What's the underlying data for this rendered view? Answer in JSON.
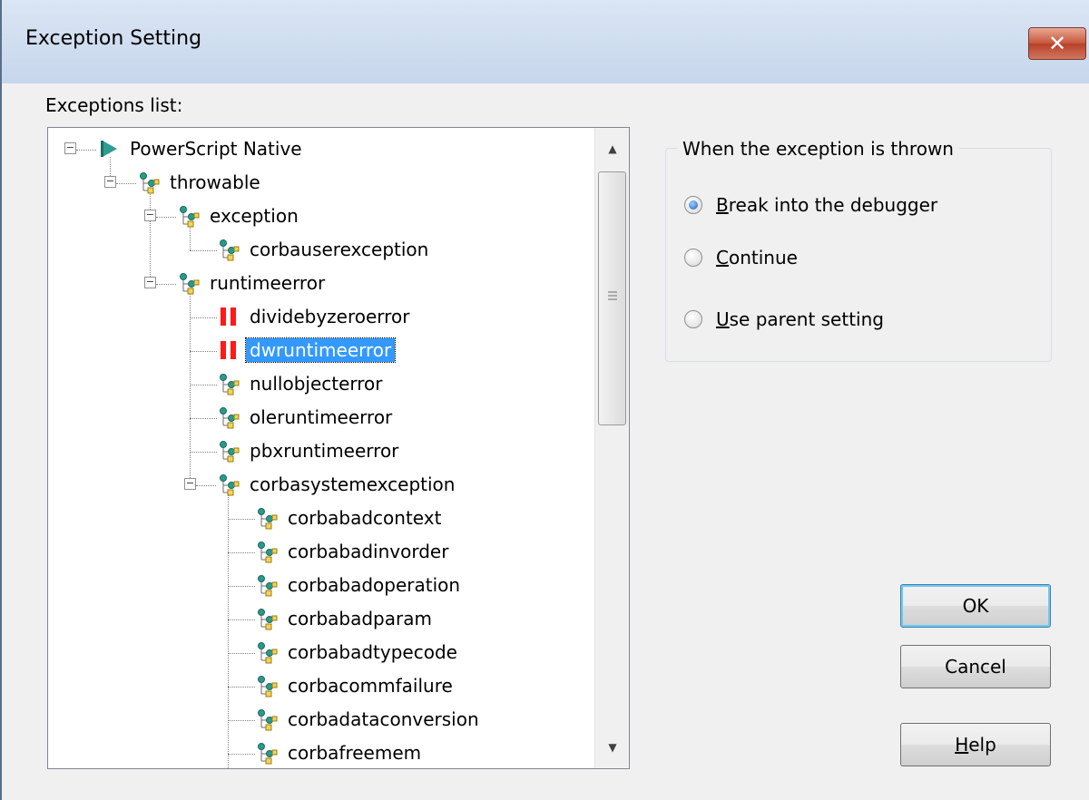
{
  "window": {
    "title": "Exception Setting",
    "close_glyph": "✕"
  },
  "exceptions_label": "Exceptions list:",
  "tree": {
    "nodes": [
      {
        "label": "PowerScript Native",
        "icon": "play-icon"
      },
      {
        "label": "throwable",
        "icon": "class-hierarchy-icon"
      },
      {
        "label": "exception",
        "icon": "class-hierarchy-icon"
      },
      {
        "label": "corbauserexception",
        "icon": "class-hierarchy-icon"
      },
      {
        "label": "runtimeerror",
        "icon": "class-hierarchy-icon"
      },
      {
        "label": "dividebyzeroerror",
        "icon": "break-icon"
      },
      {
        "label": "dwruntimeerror",
        "icon": "break-icon",
        "selected": true
      },
      {
        "label": "nullobjecterror",
        "icon": "class-hierarchy-icon"
      },
      {
        "label": "oleruntimeerror",
        "icon": "class-hierarchy-icon"
      },
      {
        "label": "pbxruntimeerror",
        "icon": "class-hierarchy-icon"
      },
      {
        "label": "corbasystemexception",
        "icon": "class-hierarchy-icon"
      },
      {
        "label": "corbabadcontext",
        "icon": "class-hierarchy-icon"
      },
      {
        "label": "corbabadinvorder",
        "icon": "class-hierarchy-icon"
      },
      {
        "label": "corbabadoperation",
        "icon": "class-hierarchy-icon"
      },
      {
        "label": "corbabadparam",
        "icon": "class-hierarchy-icon"
      },
      {
        "label": "corbabadtypecode",
        "icon": "class-hierarchy-icon"
      },
      {
        "label": "corbacommfailure",
        "icon": "class-hierarchy-icon"
      },
      {
        "label": "corbadataconversion",
        "icon": "class-hierarchy-icon"
      },
      {
        "label": "corbafreemem",
        "icon": "class-hierarchy-icon"
      }
    ],
    "expander_glyph": "−",
    "scroll_up_glyph": "▲",
    "scroll_down_glyph": "▼"
  },
  "group": {
    "legend": "When the exception is thrown",
    "options": [
      {
        "mnemonic": "B",
        "rest": "reak into the debugger",
        "checked": true
      },
      {
        "mnemonic": "C",
        "rest": "ontinue",
        "checked": false
      },
      {
        "mnemonic": "U",
        "rest": "se parent setting",
        "checked": false
      }
    ]
  },
  "buttons": {
    "ok": "OK",
    "cancel": "Cancel",
    "help_mnemonic": "H",
    "help_rest": "elp"
  }
}
